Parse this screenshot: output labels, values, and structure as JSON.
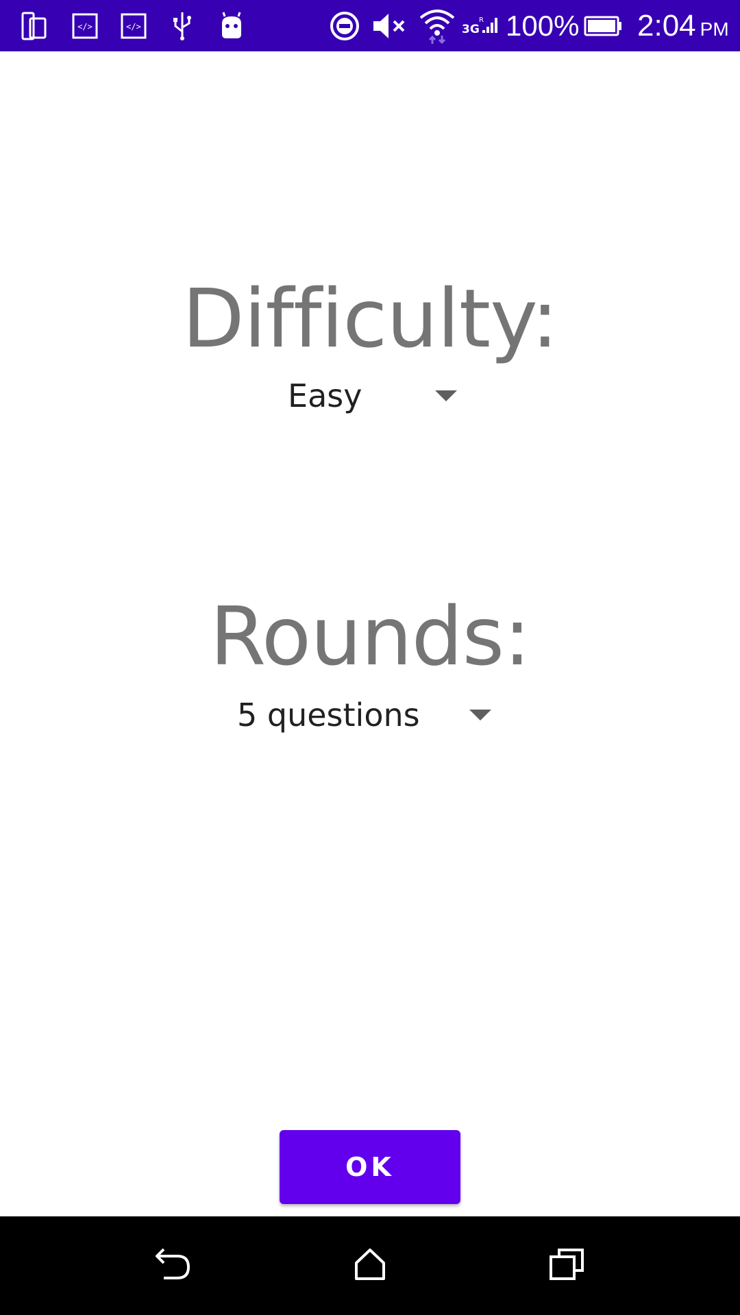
{
  "status_bar": {
    "icons": [
      "device-icon",
      "code-icon",
      "code-icon",
      "usb-icon",
      "android-icon",
      "dnd-icon",
      "mute-icon",
      "wifi-icon",
      "signal-icon",
      "battery-icon"
    ],
    "signal_label": "3G",
    "battery_percent": "100%",
    "time": "2:04",
    "ampm": "PM",
    "background_color": "#3700b3"
  },
  "settings": {
    "difficulty_label": "Difficulty:",
    "difficulty_value": "Easy",
    "rounds_label": "Rounds:",
    "rounds_value": "5 questions"
  },
  "ok_button": {
    "label": "OK",
    "color": "#6200ee"
  },
  "nav_bar": {
    "icons": [
      "back-icon",
      "home-icon",
      "recents-icon"
    ]
  }
}
